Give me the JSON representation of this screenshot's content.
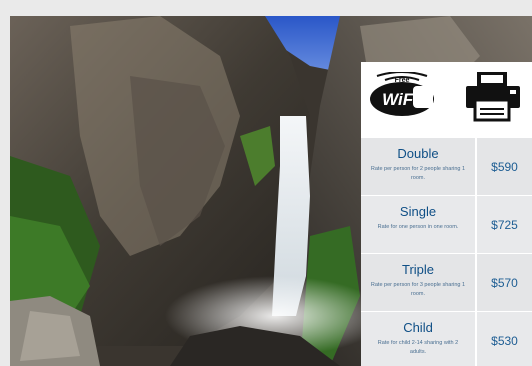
{
  "amenities": {
    "wifi_badge_top": "Free",
    "wifi_badge_text": "WiFi",
    "printer_icon": "printer-icon"
  },
  "rooms": [
    {
      "name": "Double",
      "note": "Rate per person for 2 people sharing 1 room.",
      "price": "$590"
    },
    {
      "name": "Single",
      "note": "Rate for one person in one room.",
      "price": "$725"
    },
    {
      "name": "Triple",
      "note": "Rate per person for 3 people sharing 1 room.",
      "price": "$570"
    },
    {
      "name": "Child",
      "note": "Rate for child 2-14 sharing with 2 adults.",
      "price": "$530"
    }
  ],
  "colors": {
    "accent": "#1d5d93",
    "row_bg": "#e4e5e7",
    "page_bg": "#eaeaea"
  }
}
